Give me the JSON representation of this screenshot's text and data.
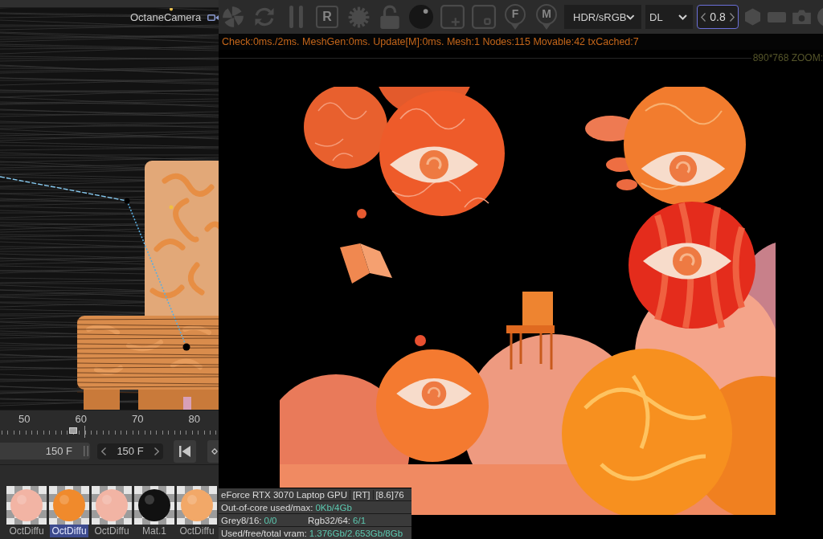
{
  "viewport": {
    "camera_label": "OctaneCamera"
  },
  "timeline": {
    "frame_labels": [
      "50",
      "60",
      "70",
      "80"
    ],
    "playhead": {
      "level": 0.335
    },
    "range_end": "150 F",
    "current_frame": "150 F"
  },
  "materials": [
    {
      "name": "OctDiffu",
      "selected": false,
      "color": "#f2b4a4"
    },
    {
      "name": "OctDiffu",
      "selected": true,
      "color": "#f08a2c"
    },
    {
      "name": "OctDiffu",
      "selected": false,
      "color": "#f2b4a4"
    },
    {
      "name": "Mat.1",
      "selected": false,
      "color": "#111111"
    },
    {
      "name": "OctDiffu",
      "selected": false,
      "color": "#f2a868"
    }
  ],
  "toolbar": {
    "buttons": [
      {
        "kind": "icon"
      },
      {
        "kind": "icon"
      },
      {
        "kind": "icon"
      },
      {
        "kind": "boxed",
        "label": "R"
      },
      {
        "kind": "icon"
      },
      {
        "kind": "icon"
      },
      {
        "kind": "icon"
      },
      {
        "kind": "icon"
      },
      {
        "kind": "icon"
      },
      {
        "kind": "pin",
        "label": "F"
      },
      {
        "kind": "pin",
        "label": "M"
      }
    ],
    "dropdowns": [
      {
        "value": "HDR/sRGB"
      },
      {
        "value": "DL"
      }
    ],
    "spinner": {
      "value": "0.8",
      "focused": true
    }
  },
  "render": {
    "stats": "Check:0ms./2ms. MeshGen:0ms. Update[M]:0ms. Mesh:1 Nodes:115 Movable:42 txCached:7",
    "resolution": "890*768 ZOOM:"
  },
  "gpu_panel": {
    "rows": [
      {
        "kind": "device",
        "cells": [
          {
            "label": "eForce RTX 3070 Laptop GPU"
          },
          {
            "label": "[RT]"
          },
          {
            "label": "[8.6]76"
          }
        ]
      },
      {
        "kind": "readout",
        "cells": [
          {
            "label": "Out-of-core used/max:",
            "value": "0Kb/4Gb"
          }
        ]
      },
      {
        "kind": "readout",
        "cells": [
          {
            "label": "Grey8/16:",
            "value": "0/0"
          },
          {
            "label": "Rgb32/64:",
            "value": "6/1"
          }
        ]
      },
      {
        "kind": "readout",
        "cells": [
          {
            "label": "Used/free/total vram:",
            "value": "1.376Gb/2.653Gb/8Gb"
          }
        ]
      }
    ]
  }
}
